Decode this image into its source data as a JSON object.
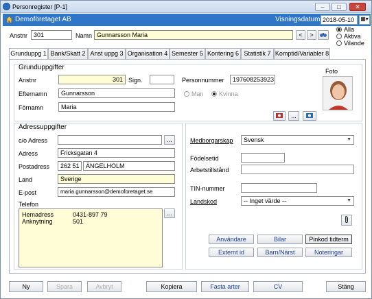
{
  "window": {
    "title": "Personregister [P-1]",
    "minimize": "‒",
    "maximize": "□",
    "close": "✕"
  },
  "company": {
    "name": "Demoföretaget AB",
    "visningsdatum_label": "Visningsdatum",
    "visningsdatum": "2018-05-10"
  },
  "header": {
    "anstnr_label": "Anstnr",
    "anstnr": "301",
    "namn_label": "Namn",
    "namn": "Gunnarsson Maria",
    "prev": "<",
    "next": ">",
    "filter": [
      {
        "label": "Alla",
        "checked": true
      },
      {
        "label": "Aktiva",
        "checked": false
      },
      {
        "label": "Vilande",
        "checked": false
      }
    ]
  },
  "tabs": [
    "Grunduppg 1",
    "Bank/Skatt 2",
    "Anst uppg 3",
    "Organisation 4",
    "Semester 5",
    "Kontering 6",
    "Statistik 7",
    "Komptid/Variabler 8"
  ],
  "grund": {
    "title": "Grunduppgifter",
    "anstnr_label": "Anstnr",
    "anstnr": "301",
    "sign_label": "Sign.",
    "sign": "",
    "pnr_label": "Personnummer",
    "pnr": "197608253923",
    "efternamn_label": "Efternamn",
    "efternamn": "Gunnarsson",
    "fornamn_label": "Förnamn",
    "fornamn": "Maria",
    "man": "Man",
    "kvinna": "Kvinna",
    "foto_label": "Foto",
    "ellipsis": "..."
  },
  "adress": {
    "title": "Adressuppgifter",
    "co_label": "c/o Adress",
    "co": "",
    "adress_label": "Adress",
    "adress": "Fricksgatan 4",
    "postadress_label": "Postadress",
    "postnr": "262 51",
    "ort": "ÄNGELHOLM",
    "land_label": "Land",
    "land": "Sverige",
    "epost_label": "E-post",
    "epost": "maria.gunnarsson@demoforetaget.se",
    "telefon_label": "Telefon",
    "telefon": [
      {
        "type": "Hemadress",
        "number": "0431-897 79"
      },
      {
        "type": "Anknytning",
        "number": "501"
      }
    ],
    "ellipsis": "..."
  },
  "right": {
    "medborgarskap_label": "Medborgarskap",
    "medborgarskap": "Svensk",
    "fodelsetid_label": "Födelsetid",
    "fodelsetid": "",
    "arbetstillstand_label": "Arbetstillstånd",
    "arbetstillstand": "",
    "tin_label": "TIN-nummer",
    "tin": "",
    "landskod_label": "Landskod",
    "landskod": "-- Inget värde --",
    "buttons": [
      "Användare",
      "Bilar",
      "Pinkod tidterm",
      "Externt id",
      "Barn/Närst",
      "Noteringar"
    ]
  },
  "bottom": {
    "ny": "Ny",
    "spara": "Spara",
    "avbryt": "Avbryt",
    "kopiera": "Kopiera",
    "fasta_arter": "Fasta arter",
    "cv": "CV",
    "stang": "Stäng"
  }
}
